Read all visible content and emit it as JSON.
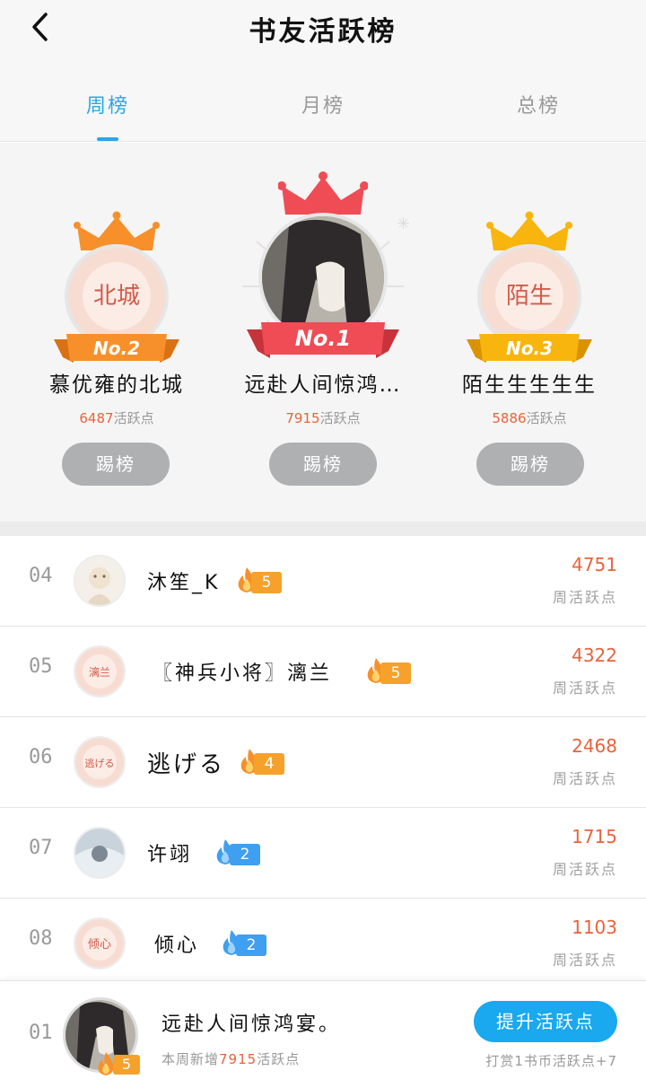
{
  "header": {
    "title": "书友活跃榜"
  },
  "tabs": [
    {
      "label": "周榜",
      "active": true
    },
    {
      "label": "月榜",
      "active": false
    },
    {
      "label": "总榜",
      "active": false
    }
  ],
  "podium": [
    {
      "rank_label": "No.2",
      "name": "慕优雍的北城",
      "points": "6487",
      "points_unit": "活跃点",
      "kick_label": "踢榜",
      "avatar_text": "北城",
      "crown_color": "#f7902a",
      "ribbon_color": "#f7902a"
    },
    {
      "rank_label": "No.1",
      "name": "远赴人间惊鸿…",
      "points": "7915",
      "points_unit": "活跃点",
      "kick_label": "踢榜",
      "avatar_text": "",
      "crown_color": "#ef4c55",
      "ribbon_color": "#ef4c55"
    },
    {
      "rank_label": "No.3",
      "name": "陌生生生生生",
      "points": "5886",
      "points_unit": "活跃点",
      "kick_label": "踢榜",
      "avatar_text": "陌生",
      "crown_color": "#f8b50d",
      "ribbon_color": "#f8b50d"
    }
  ],
  "list": [
    {
      "rank": "04",
      "name": "沐笙_K",
      "level": "5",
      "fire": "orange",
      "score": "4751",
      "score_label": "周活跃点",
      "avatar_text": ""
    },
    {
      "rank": "05",
      "name": "〖神兵小将〗漓兰",
      "level": "5",
      "fire": "orange",
      "score": "4322",
      "score_label": "周活跃点",
      "avatar_text": "漓兰"
    },
    {
      "rank": "06",
      "name": "逃げる",
      "level": "4",
      "fire": "orange",
      "score": "2468",
      "score_label": "周活跃点",
      "avatar_text": "逃げる"
    },
    {
      "rank": "07",
      "name": "许翊",
      "level": "2",
      "fire": "blue",
      "score": "1715",
      "score_label": "周活跃点",
      "avatar_text": ""
    },
    {
      "rank": "08",
      "name": "倾心",
      "level": "2",
      "fire": "blue",
      "score": "1103",
      "score_label": "周活跃点",
      "avatar_text": "倾心"
    }
  ],
  "me": {
    "rank": "01",
    "name": "远赴人间惊鸿宴。",
    "level": "5",
    "sub_prefix": "本周新增",
    "sub_points": "7915",
    "sub_suffix": "活跃点",
    "boost_label": "提升活跃点",
    "tip": "打赏1书币活跃点+7"
  },
  "icons": {
    "back": "chevron-left-icon",
    "crown": "crown-icon",
    "fire": "flame-icon"
  }
}
